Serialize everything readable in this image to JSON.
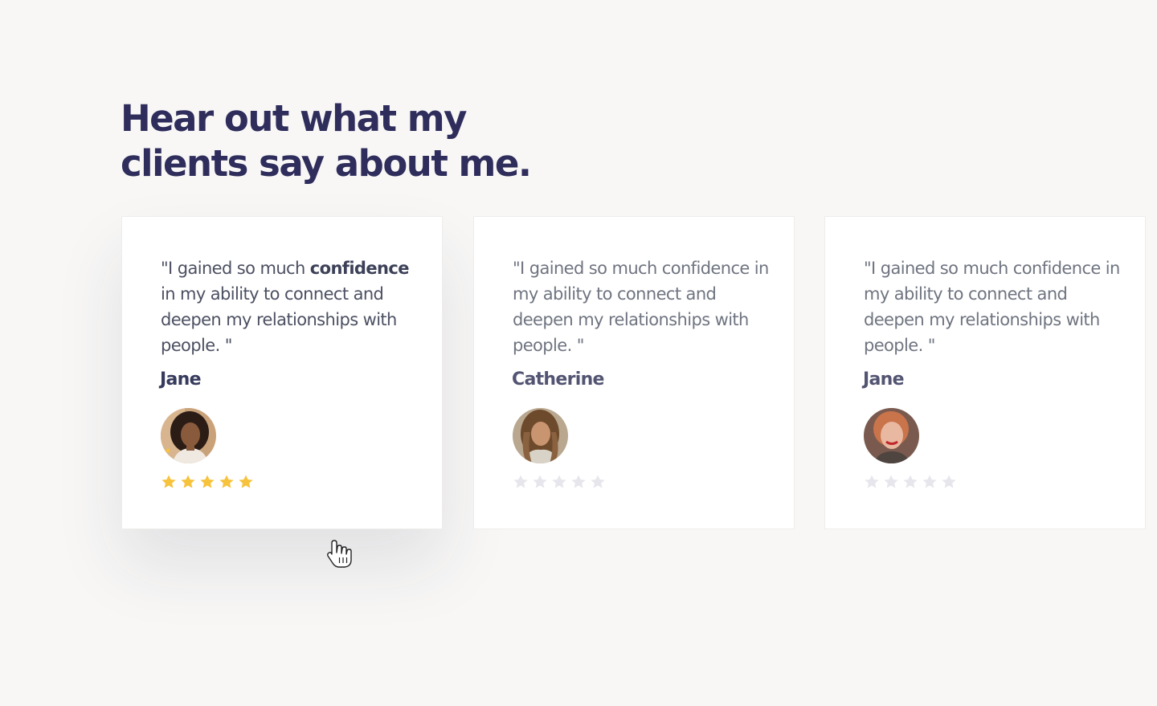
{
  "section": {
    "title_line1": "Hear out what my",
    "title_line2": "clients say about me."
  },
  "testimonials": [
    {
      "quote_before": "\"I gained so much ",
      "quote_bold": "confidence",
      "quote_after": " in my ability to connect and deepen my relationships with people. \"",
      "name": "Jane",
      "avatar_icon": "woman-curly-hair-avatar",
      "rating": 5
    },
    {
      "quote_before": "\"I gained so much ",
      "quote_bold": "",
      "quote_after": "confidence in my ability to connect and deepen my relationships with people. \"",
      "name": "Catherine",
      "avatar_icon": "woman-long-hair-avatar",
      "rating": 0
    },
    {
      "quote_before": "\"I gained so much ",
      "quote_bold": "",
      "quote_after": "confidence in my ability to connect and deepen my relationships with people. \"",
      "name": "Jane",
      "avatar_icon": "woman-red-hair-avatar",
      "rating": 0
    }
  ],
  "colors": {
    "heading": "#2f2d5b",
    "star_filled": "#f7c23c",
    "star_empty": "#e6e6ec",
    "background": "#f8f7f6"
  }
}
